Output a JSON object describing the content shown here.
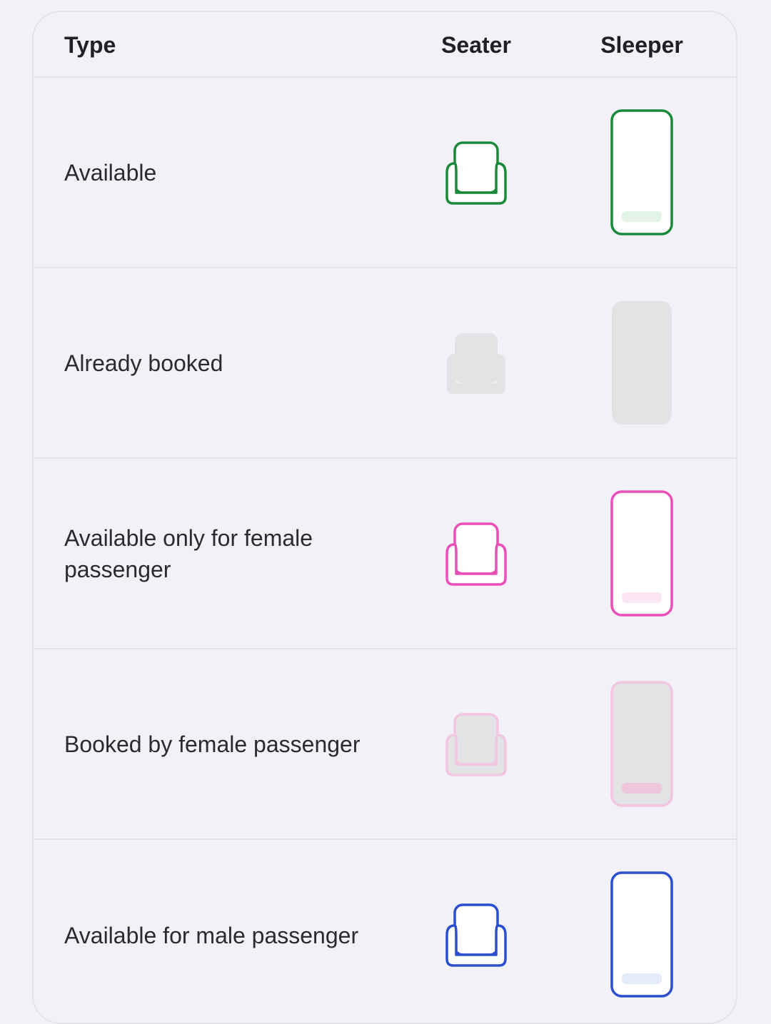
{
  "table": {
    "headers": {
      "type": "Type",
      "seater": "Seater",
      "sleeper": "Sleeper"
    },
    "rows": [
      {
        "label": "Available",
        "seater_icon": "seat-available-icon",
        "sleeper_icon": "sleeper-available-icon",
        "colors": {
          "stroke": "#1a8a3a",
          "fill": "#ffffff",
          "pillow": "#e3f3e7"
        }
      },
      {
        "label": "Already booked",
        "seater_icon": "seat-booked-icon",
        "sleeper_icon": "sleeper-booked-icon",
        "colors": {
          "stroke": "none",
          "fill": "#e3e3e6",
          "pillow": "none"
        }
      },
      {
        "label": "Available only for female passenger",
        "seater_icon": "seat-female-available-icon",
        "sleeper_icon": "sleeper-female-available-icon",
        "colors": {
          "stroke": "#ea4fb8",
          "fill": "#ffffff",
          "pillow": "#fde6f4"
        }
      },
      {
        "label": "Booked by female passenger",
        "seater_icon": "seat-female-booked-icon",
        "sleeper_icon": "sleeper-female-booked-icon",
        "colors": {
          "stroke": "#f1c6e1",
          "fill": "#e3e3e6",
          "pillow": "#eec7dc"
        }
      },
      {
        "label": "Available for male passenger",
        "seater_icon": "seat-male-available-icon",
        "sleeper_icon": "sleeper-male-available-icon",
        "colors": {
          "stroke": "#2a4fcf",
          "fill": "#ffffff",
          "pillow": "#e6ebfb"
        }
      }
    ]
  }
}
